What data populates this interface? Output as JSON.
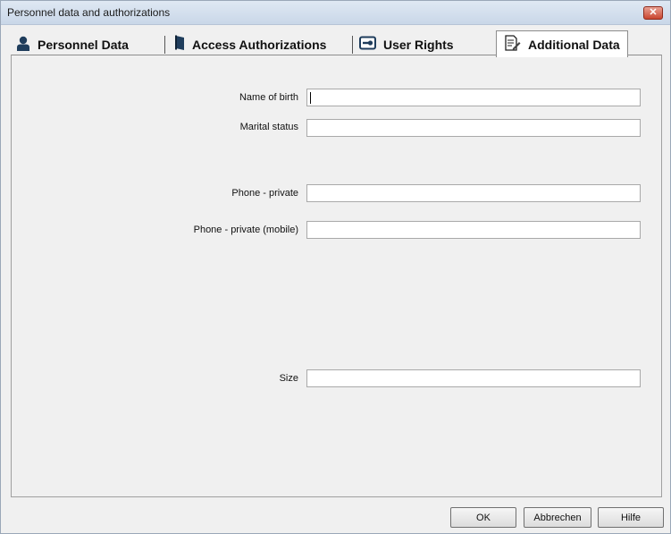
{
  "window": {
    "title": "Personnel data and authorizations",
    "close_icon": "close-icon"
  },
  "tabs": [
    {
      "label": "Personnel Data",
      "icon": "person-icon",
      "active": false
    },
    {
      "label": "Access Authorizations",
      "icon": "door-icon",
      "active": false
    },
    {
      "label": "User Rights",
      "icon": "key-card-icon",
      "active": false
    },
    {
      "label": "Additional Data",
      "icon": "document-edit-icon",
      "active": true
    }
  ],
  "form": {
    "name_of_birth": {
      "label": "Name of birth",
      "value": ""
    },
    "marital_status": {
      "label": "Marital status",
      "value": ""
    },
    "phone_private": {
      "label": "Phone - private",
      "value": ""
    },
    "phone_private_mobile": {
      "label": "Phone - private (mobile)",
      "value": ""
    },
    "size": {
      "label": "Size",
      "value": ""
    }
  },
  "buttons": {
    "ok": "OK",
    "cancel": "Abbrechen",
    "help": "Hilfe"
  },
  "colors": {
    "titlebar": "#c9d7e8",
    "close_button": "#c9452f",
    "panel_background": "#f0f0f0",
    "person_icon": "#1f3d5c",
    "door_icon": "#1f3d5c"
  }
}
